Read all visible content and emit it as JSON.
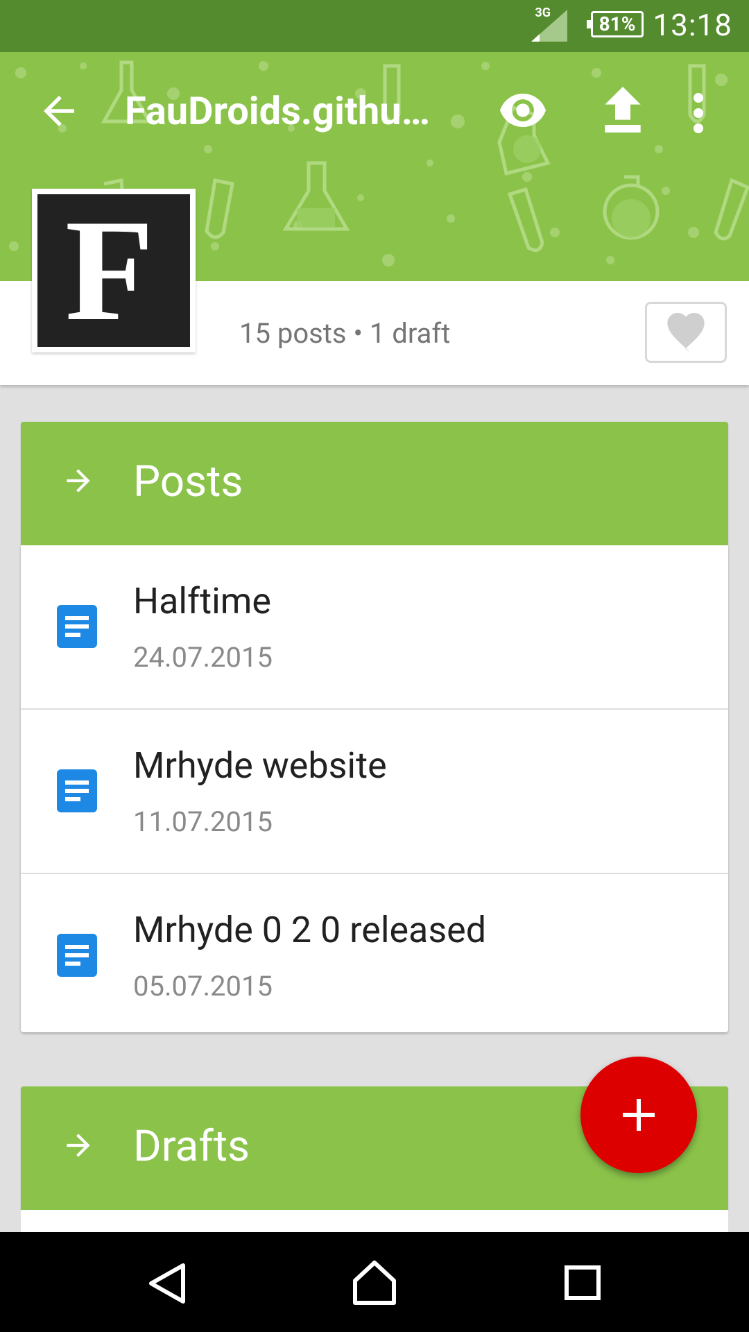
{
  "statusbar": {
    "network": "3G",
    "battery": "81%",
    "time": "13:18"
  },
  "header": {
    "title": "FauDroids.githu…",
    "icons": [
      "back-arrow-icon",
      "eye-icon",
      "upload-icon",
      "more-vert-icon"
    ],
    "avatar_letter": "F"
  },
  "info": {
    "stats": "15 posts • 1 draft"
  },
  "sections": {
    "posts_label": "Posts",
    "drafts_label": "Drafts"
  },
  "posts": [
    {
      "title": "Halftime",
      "date": "24.07.2015"
    },
    {
      "title": "Mrhyde website",
      "date": "11.07.2015"
    },
    {
      "title": "Mrhyde 0 2 0 released",
      "date": "05.07.2015"
    }
  ],
  "colors": {
    "primary": "#8bc34a",
    "primary_dark": "#558b2f",
    "accent": "#dd0000",
    "doc_icon": "#1e88e5"
  }
}
